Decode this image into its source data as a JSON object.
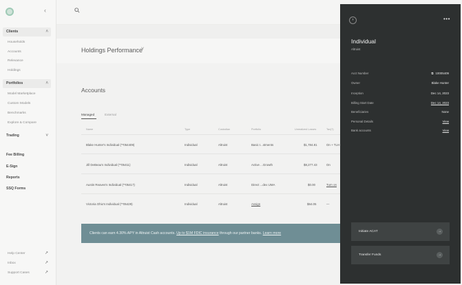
{
  "sidebar": {
    "sections": [
      {
        "label": "Clients",
        "sub": [
          "Households",
          "Accounts",
          "Relevance",
          "Holdings"
        ]
      },
      {
        "label": "Portfolios",
        "sub": [
          "Model Marketplace",
          "Custom Models",
          "Benchmarks",
          "Explore & Compare"
        ]
      }
    ],
    "trading": "Trading",
    "top_items": [
      "Fee Billing",
      "E-Sign",
      "Reports",
      "SSQ Forms"
    ],
    "footer": [
      "Help Center",
      "Inbox",
      "Support Cases"
    ]
  },
  "holdings": {
    "title": "Holdings Performance"
  },
  "accounts": {
    "title": "Accounts",
    "tabs": [
      "Managed",
      "External"
    ],
    "columns": [
      "Name",
      "Type",
      "Custodian",
      "Portfolio",
      "Unrealized Losses",
      "Tax(?)"
    ],
    "rows": [
      {
        "name": "Blake Hunter's Individual (**054409)",
        "type": "Individual",
        "custodian": "Altruist",
        "portfolio": "Basic I...stments",
        "losses": "$1,784.81",
        "tax": "On + TLH"
      },
      {
        "name": "Jill DeBeau's Individual (**05411)",
        "type": "Individual",
        "custodian": "Altruist",
        "portfolio": "Active ...Growth",
        "losses": "$8,277.43",
        "tax": "On"
      },
      {
        "name": "Austin Reaves's Individual (**05417)",
        "type": "Individual",
        "custodian": "Altruist",
        "portfolio": "Direct ...dex UMA",
        "losses": "$0.00",
        "tax": "Turn on"
      },
      {
        "name": "Victoria Ohio's Individual (**05429)",
        "type": "Individual",
        "custodian": "Altruist",
        "portfolio": "Assign",
        "losses": "$64.05",
        "tax": "—"
      }
    ]
  },
  "banner": {
    "text1": "Clients can earn 4.30% APY in Altruist Cash accounts. ",
    "link1": "Up to $1M FDIC insurance",
    "text2": " through our partner banks. ",
    "link2": "Learn more"
  },
  "panel": {
    "title": "Individual",
    "subtitle": "Altruist",
    "fields": [
      {
        "label": "Acct Number",
        "value": "10005409"
      },
      {
        "label": "Owner",
        "value": "Blake Hunter"
      },
      {
        "label": "Inception",
        "value": "Dec 14, 2023"
      },
      {
        "label": "Billing Start Date",
        "value": "Dec 14, 2023"
      },
      {
        "label": "Beneficiaries",
        "value": "None"
      },
      {
        "label": "Personal Details",
        "value": "View"
      },
      {
        "label": "Bank accounts",
        "value": "View"
      }
    ],
    "actions": [
      "Initiate ACAT",
      "Transfer Funds"
    ]
  }
}
